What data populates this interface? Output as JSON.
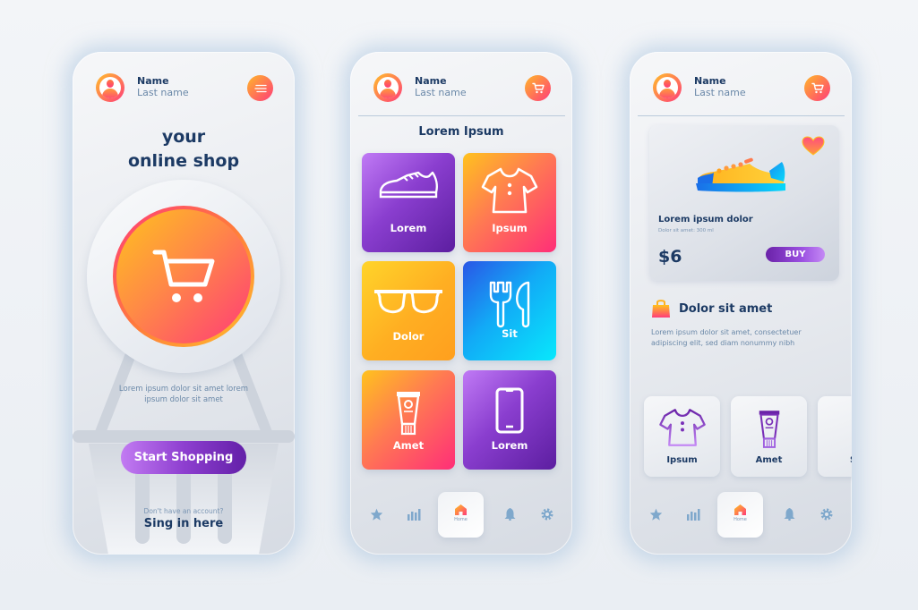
{
  "colors": {
    "navy": "#1c3a64",
    "muted_text": "#6a88a8",
    "accent_orange": "#ffc21e",
    "accent_pink": "#ff3c7a",
    "accent_purple": "#8a3ecf",
    "nav_icon": "#7fa8cc"
  },
  "screens": [
    {
      "id": "welcome",
      "header": {
        "name": "Name",
        "last_name": "Last name",
        "action_icon": "menu-icon"
      },
      "title_line1": "your",
      "title_line2": "online shop",
      "hero_icon": "shopping-cart-icon",
      "description": "Lorem ipsum dolor sit amet lorem ipsum dolor sit amet",
      "start_button": "Start Shopping",
      "no_account": "Don't have an account?",
      "signin_link": "Sing in here"
    },
    {
      "id": "categories",
      "header": {
        "name": "Name",
        "last_name": "Last name",
        "action_icon": "cart-icon"
      },
      "title": "Lorem Ipsum",
      "categories": [
        {
          "label": "Lorem",
          "icon": "sneaker-icon"
        },
        {
          "label": "Ipsum",
          "icon": "tshirt-icon"
        },
        {
          "label": "Dolor",
          "icon": "glasses-icon"
        },
        {
          "label": "Sit",
          "icon": "fork-knife-icon"
        },
        {
          "label": "Amet",
          "icon": "cream-tube-icon"
        },
        {
          "label": "Lorem",
          "icon": "smartphone-icon"
        }
      ],
      "nav": {
        "items": [
          "star-icon",
          "chart-icon",
          "home-icon",
          "bell-icon",
          "gear-icon"
        ],
        "active": "Home",
        "home_label": "Home"
      }
    },
    {
      "id": "product",
      "header": {
        "name": "Name",
        "last_name": "Last name",
        "action_icon": "cart-icon"
      },
      "product": {
        "title": "Lorem ipsum dolor",
        "subtitle": "Dolor sit amet: 300 ml",
        "price": "$6",
        "buy_label": "BUY",
        "favorite": true
      },
      "section": {
        "title": "Dolor sit amet",
        "description": "Lorem ipsum dolor sit amet, consectetuer adipiscing elit, sed diam nonummy nibh"
      },
      "mini_categories": [
        {
          "label": "Ipsum",
          "icon": "tshirt-icon"
        },
        {
          "label": "Amet",
          "icon": "cream-tube-icon"
        },
        {
          "label": "S",
          "icon": ""
        }
      ],
      "nav": {
        "items": [
          "star-icon",
          "chart-icon",
          "home-icon",
          "bell-icon",
          "gear-icon"
        ],
        "active": "Home",
        "home_label": "Home"
      }
    }
  ]
}
